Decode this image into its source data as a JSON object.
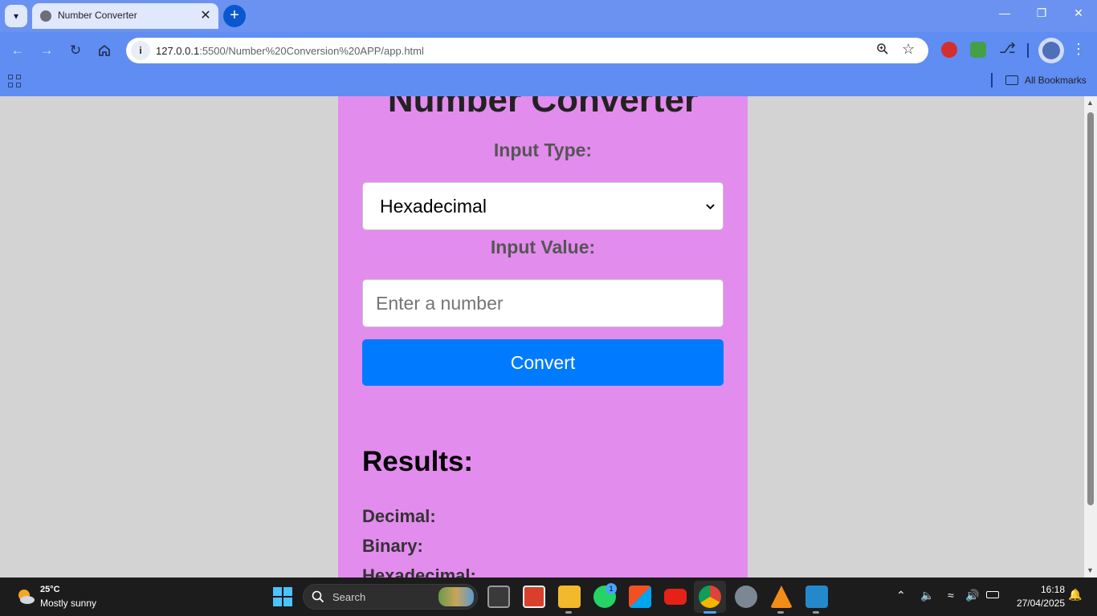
{
  "browser": {
    "tab_title": "Number Converter",
    "tab_close": "✕",
    "new_tab": "+",
    "url_host": "127.0.0.1",
    "url_rest": ":5500/Number%20Conversion%20APP/app.html",
    "bookmarks_label": "All Bookmarks"
  },
  "app": {
    "title": "Number Converter",
    "input_type_label": "Input Type:",
    "selected_type": "Hexadecimal",
    "input_value_label": "Input Value:",
    "input_placeholder": "Enter a number",
    "input_value": "",
    "convert_label": "Convert",
    "results_title": "Results:",
    "results": [
      {
        "label": "Decimal:",
        "value": ""
      },
      {
        "label": "Binary:",
        "value": ""
      },
      {
        "label": "Hexadecimal:",
        "value": ""
      }
    ]
  },
  "taskbar": {
    "weather_temp": "25°C",
    "weather_desc": "Mostly sunny",
    "search_placeholder": "Search",
    "whatsapp_badge": "1",
    "time": "16:18",
    "date": "27/04/2025"
  },
  "colors": {
    "card_bg": "#e28ced",
    "page_bg": "#d3d3d3",
    "convert_button": "#007bff",
    "browser_frame": "#6b92f0"
  },
  "icons": {
    "tab_search": "chevron-down-icon",
    "back": "arrow-left-icon",
    "forward": "arrow-right-icon",
    "reload": "reload-icon",
    "home": "home-icon",
    "zoom": "zoom-icon",
    "bookmark": "star-icon",
    "extensions": "puzzle-icon"
  }
}
